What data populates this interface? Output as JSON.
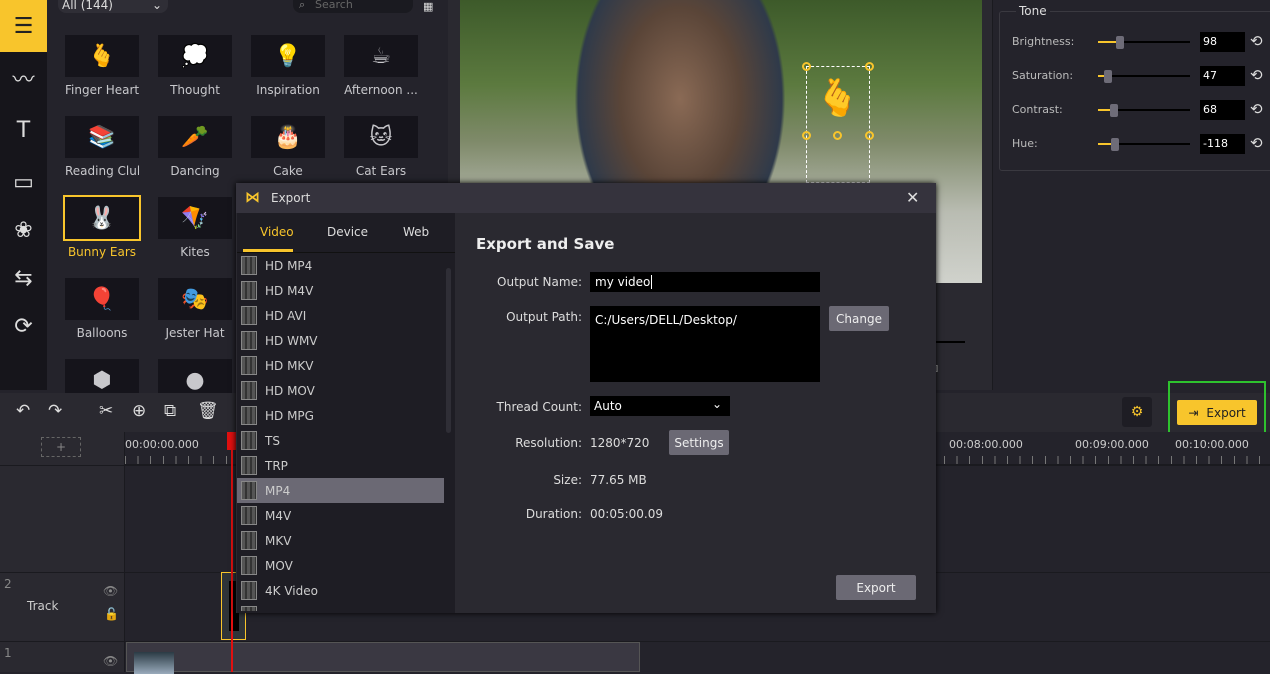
{
  "sidebar": {
    "icons": [
      "layers-icon",
      "audio-wave-icon",
      "text-icon",
      "template-icon",
      "filter-icon",
      "transition-icon",
      "rotate-icon"
    ]
  },
  "stickers": {
    "category": "All (144)",
    "search_placeholder": "Search",
    "items": [
      {
        "label": "Finger Heart",
        "glyph": "🫰"
      },
      {
        "label": "Thought",
        "glyph": "💭"
      },
      {
        "label": "Inspiration",
        "glyph": "💡"
      },
      {
        "label": "Afternoon ...",
        "glyph": "☕"
      },
      {
        "label": "Reading Club",
        "glyph": "📚"
      },
      {
        "label": "Dancing",
        "glyph": "🥕"
      },
      {
        "label": "Cake",
        "glyph": "🎂"
      },
      {
        "label": "Cat Ears",
        "glyph": "🐱"
      },
      {
        "label": "Bunny Ears",
        "glyph": "🐰"
      },
      {
        "label": "Kites",
        "glyph": "🪁"
      },
      {
        "label": "",
        "glyph": ""
      },
      {
        "label": "",
        "glyph": ""
      },
      {
        "label": "Balloons",
        "glyph": "🎈"
      },
      {
        "label": "Jester Hat",
        "glyph": "🎭"
      },
      {
        "label": "",
        "glyph": ""
      },
      {
        "label": "",
        "glyph": ""
      },
      {
        "label": "",
        "glyph": "⬢"
      },
      {
        "label": "",
        "glyph": "●"
      }
    ],
    "selected": "Bunny Ears"
  },
  "tone": {
    "title": "Tone",
    "rows": [
      {
        "label": "Brightness:",
        "value": "98",
        "level": 0.22
      },
      {
        "label": "Saturation:",
        "value": "47",
        "level": 0.09
      },
      {
        "label": "Contrast:",
        "value": "68",
        "level": 0.15
      },
      {
        "label": "Hue:",
        "value": "-118",
        "level": 0.16
      }
    ]
  },
  "toolbar": {
    "export_label": "Export"
  },
  "timeline": {
    "ticks": [
      "00:00:00.000",
      "00:08:00.000",
      "00:09:00.000",
      "00:10:00.000"
    ],
    "tracks": [
      {
        "num": "2",
        "label": "Track"
      },
      {
        "num": "1",
        "label": ""
      }
    ]
  },
  "dialog": {
    "title": "Export",
    "tabs": [
      "Video",
      "Device",
      "Web"
    ],
    "active_tab": "Video",
    "formats": [
      "HD MP4",
      "HD M4V",
      "HD AVI",
      "HD WMV",
      "HD MKV",
      "HD MOV",
      "HD MPG",
      "TS",
      "TRP",
      "MP4",
      "M4V",
      "MKV",
      "MOV",
      "4K Video"
    ],
    "selected_format": "MP4",
    "heading": "Export and Save",
    "output_name_label": "Output Name:",
    "output_name": "my video",
    "output_path_label": "Output Path:",
    "output_path": "C:/Users/DELL/Desktop/",
    "change_label": "Change",
    "thread_label": "Thread Count:",
    "thread_value": "Auto",
    "resolution_label": "Resolution:",
    "resolution": "1280*720",
    "settings_label": "Settings",
    "size_label": "Size:",
    "size": "77.65 MB",
    "duration_label": "Duration:",
    "duration": "00:05:00.09",
    "export_label": "Export"
  },
  "colors": {
    "accent": "#f8c52c",
    "highlight": "#2ec22e",
    "playhead": "#e01010"
  }
}
